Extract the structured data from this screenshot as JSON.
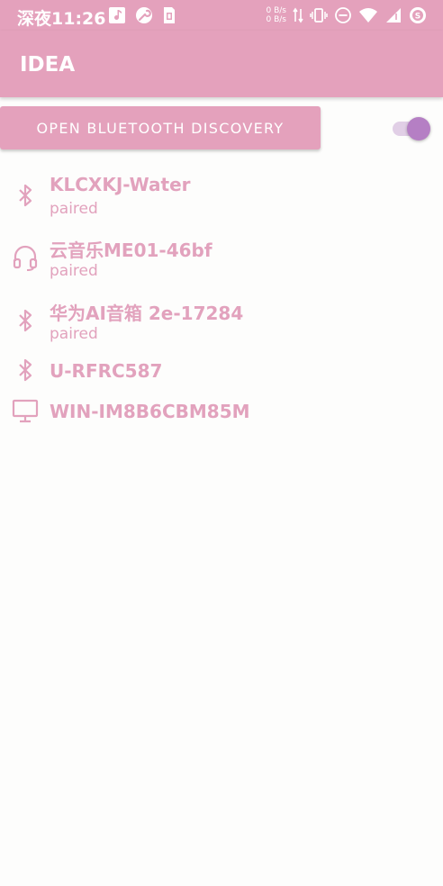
{
  "status_bar": {
    "time": "深夜11:26",
    "speed_up": "0 B/s",
    "speed_down": "0 B/s",
    "left_icons": [
      "music-note-icon",
      "wrench-icon",
      "sim-card-icon"
    ],
    "right_icons": [
      "data-arrows-icon",
      "vibrate-icon",
      "do-not-disturb-icon",
      "wifi-icon",
      "cellular-signal-icon",
      "battery-saver-icon"
    ]
  },
  "app_bar": {
    "title": "IDEA"
  },
  "discover_button": {
    "label": "OPEN BLUETOOTH DISCOVERY"
  },
  "bluetooth_switch": {
    "on": true
  },
  "colors": {
    "primary": "#e4a1bc",
    "text_accent": "#e2a2bd",
    "switch_thumb": "#b57fc4",
    "switch_track": "#e1cfe6"
  },
  "devices": [
    {
      "name": "KLCXKJ-Water",
      "status": "paired",
      "icon": "bluetooth-icon"
    },
    {
      "name": "云音乐ME01-46bf",
      "status": "paired",
      "icon": "headset-icon"
    },
    {
      "name": "华为AI音箱 2e-17284",
      "status": "paired",
      "icon": "bluetooth-icon"
    },
    {
      "name": "U-RFRC587",
      "status": "",
      "icon": "bluetooth-icon"
    },
    {
      "name": "WIN-IM8B6CBM85M",
      "status": "",
      "icon": "computer-icon"
    }
  ]
}
